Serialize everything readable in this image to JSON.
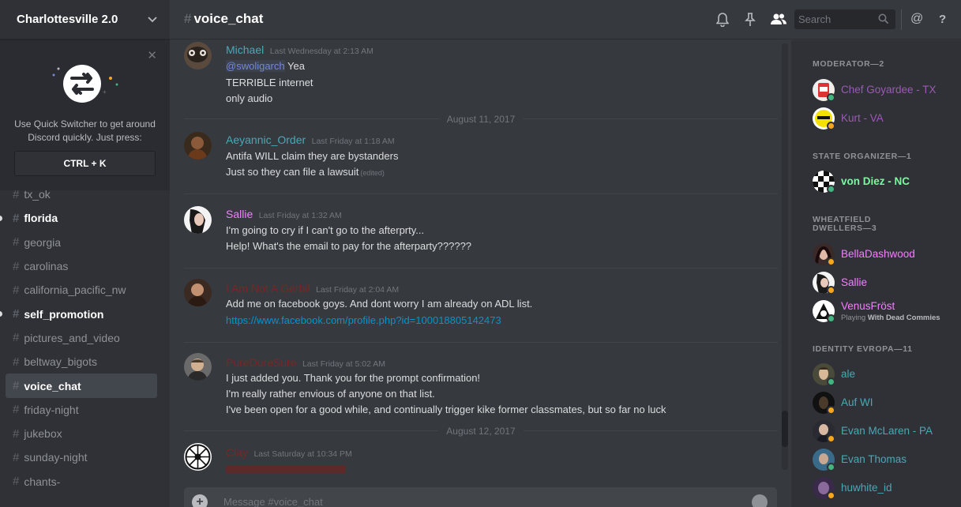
{
  "server": {
    "name": "Charlottesville 2.0"
  },
  "quick_switcher": {
    "text_line1": "Use Quick Switcher to get around",
    "text_line2": "Discord quickly. Just press:",
    "shortcut": "CTRL + K"
  },
  "channels": [
    {
      "name": "tx_ok",
      "state": "normal"
    },
    {
      "name": "florida",
      "state": "unread"
    },
    {
      "name": "georgia",
      "state": "normal"
    },
    {
      "name": "carolinas",
      "state": "normal"
    },
    {
      "name": "california_pacific_nw",
      "state": "normal"
    },
    {
      "name": "self_promotion",
      "state": "unread"
    },
    {
      "name": "pictures_and_video",
      "state": "normal"
    },
    {
      "name": "beltway_bigots",
      "state": "normal"
    },
    {
      "name": "voice_chat",
      "state": "active"
    },
    {
      "name": "friday-night",
      "state": "normal"
    },
    {
      "name": "jukebox",
      "state": "normal"
    },
    {
      "name": "sunday-night",
      "state": "normal"
    },
    {
      "name": "chants-",
      "state": "normal"
    }
  ],
  "header": {
    "hash": "#",
    "channel": "voice_chat",
    "search_placeholder": "Search"
  },
  "messages": [
    {
      "author": "Michael",
      "color": "#4aa8b6",
      "timestamp": "Last Wednesday at 2:13 AM",
      "mention": "@swoligarch",
      "lines": [
        "Yea",
        "TERRIBLE internet",
        "only audio"
      ]
    },
    {
      "author": "Aeyannic_Order",
      "color": "#4aa8b6",
      "timestamp": "Last Friday at 1:18 AM",
      "lines": [
        "Antifa WILL claim they are bystanders",
        "Just so they can file a lawsuit"
      ],
      "edited": "(edited)"
    },
    {
      "author": "Sallie",
      "color": "#f47fff",
      "timestamp": "Last Friday at 1:32 AM",
      "lines": [
        "I'm going to cry if I can't go to the afterprty...",
        "Help!  What's the email to pay for the afterparty??????"
      ]
    },
    {
      "author": "I Am Not A Gerbil",
      "color": "#7a2626",
      "timestamp": "Last Friday at 2:04 AM",
      "lines": [
        "Add me on facebook goys. And dont worry I am already on ADL list."
      ],
      "link": "https://www.facebook.com/profile.php?id=100018805142473"
    },
    {
      "author": "PureDureSure",
      "color": "#7a2626",
      "timestamp": "Last Friday at 5:02 AM",
      "lines": [
        "I just added you. Thank you for the prompt confirmation!",
        "I'm really rather envious of anyone on that list.",
        "I've been open for a good while, and continually trigger kike former classmates, but so far no luck"
      ]
    },
    {
      "author": "Clay",
      "color": "#7a2626",
      "timestamp": "Last Saturday at 10:34 PM",
      "lines": []
    }
  ],
  "date_dividers": [
    "August 11, 2017",
    "August 12, 2017"
  ],
  "composer": {
    "placeholder": "Message #voice_chat"
  },
  "roles": [
    {
      "label": "MODERATOR—2",
      "members": [
        {
          "name": "Chef Goyardee - TX",
          "color": "#9b59b6",
          "status": "online"
        },
        {
          "name": "Kurt - VA",
          "color": "#9b59b6",
          "status": "idle"
        }
      ]
    },
    {
      "label": "STATE ORGANIZER—1",
      "members": [
        {
          "name": "von Diez - NC",
          "color": "#7cf89f",
          "status": "online"
        }
      ]
    },
    {
      "label_line1": "WHEATFIELD",
      "label_line2": "DWELLERS—3",
      "members": [
        {
          "name": "BellaDashwood",
          "color": "#f47fff",
          "status": "idle"
        },
        {
          "name": "Sallie",
          "color": "#f47fff",
          "status": "idle"
        },
        {
          "name": "VenusFröst",
          "color": "#f47fff",
          "status": "online",
          "playing_prefix": "Playing",
          "playing_game": "With Dead Commies"
        }
      ]
    },
    {
      "label": "IDENTITY EVROPA—11",
      "members": [
        {
          "name": "ale",
          "color": "#4aa8b6",
          "status": "online"
        },
        {
          "name": "Auf WI",
          "color": "#4aa8b6",
          "status": "idle"
        },
        {
          "name": "Evan McLaren - PA",
          "color": "#4aa8b6",
          "status": "idle"
        },
        {
          "name": "Evan Thomas",
          "color": "#4aa8b6",
          "status": "online"
        },
        {
          "name": "huwhite_id",
          "color": "#4aa8b6",
          "status": "idle"
        }
      ]
    }
  ],
  "colors": {
    "background": "#36393e",
    "sidebar": "#2f3136",
    "accent": "#7289da"
  }
}
